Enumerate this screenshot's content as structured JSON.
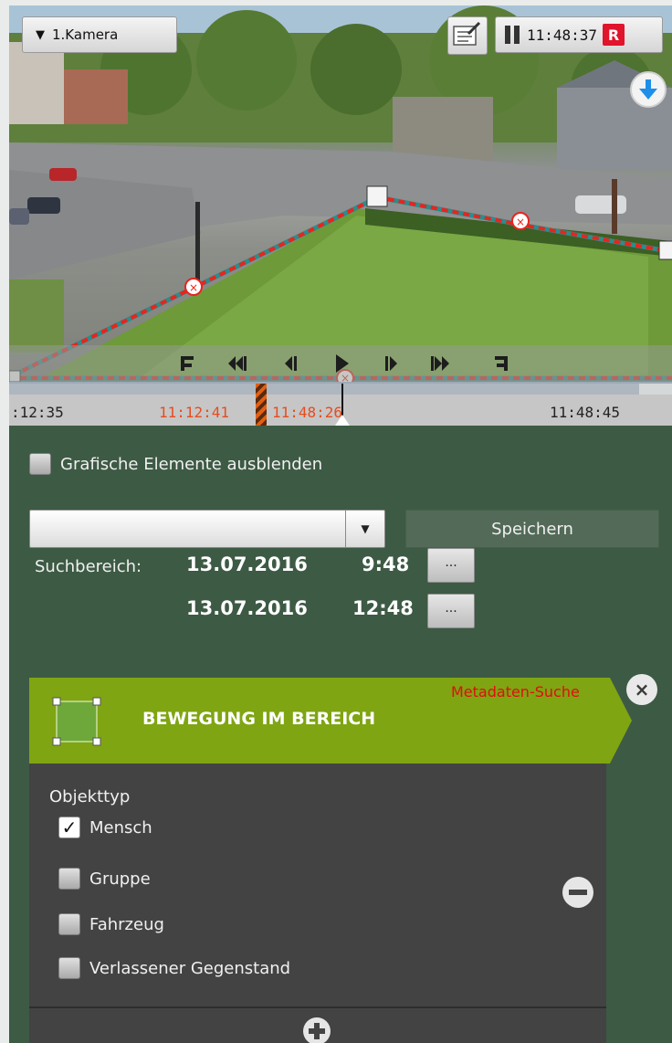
{
  "video": {
    "camera_label": "1.Kamera",
    "time": "11:48:37",
    "record_badge": "R"
  },
  "timeline": {
    "labels": [
      ":12:35",
      "11:12:41",
      "11:48:26",
      "11:48:45"
    ]
  },
  "options": {
    "hide_graphics_label": "Grafische Elemente ausblenden",
    "preset_select_value": "",
    "save_label": "Speichern",
    "search_range_label": "Suchbereich:",
    "start_date": "13.07.2016",
    "start_time": "9:48",
    "end_date": "13.07.2016",
    "end_time": "12:48",
    "ellipsis": "..."
  },
  "filter": {
    "title": "BEWEGUNG IM BEREICH",
    "meta_label": "Metadaten-Suche",
    "object_type_label": "Objekttyp",
    "object_types": [
      {
        "label": "Mensch",
        "checked": true
      },
      {
        "label": "Gruppe",
        "checked": false
      },
      {
        "label": "Fahrzeug",
        "checked": false
      },
      {
        "label": "Verlassener Gegenstand",
        "checked": false
      }
    ]
  },
  "colors": {
    "panel_bg": "#3d5a44",
    "header_green": "#7fa512",
    "record_red": "#e0142b",
    "zone_red": "#e8241d",
    "zone_teal": "#2d8c8c"
  },
  "icons": [
    "dropdown-arrow-icon",
    "edit-note-icon",
    "pause-icon",
    "download-arrow-icon",
    "go-start-icon",
    "fast-rewind-icon",
    "step-back-icon",
    "play-icon",
    "step-forward-icon",
    "fast-forward-icon",
    "go-end-icon",
    "close-icon",
    "minus-icon",
    "plus-icon",
    "area-zone-icon"
  ]
}
